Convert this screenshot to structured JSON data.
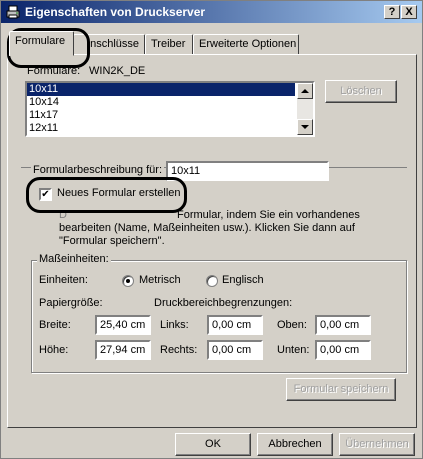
{
  "window": {
    "title": "Eigenschaften von Druckserver",
    "help_button": "?",
    "close_button": "X"
  },
  "tabs": [
    {
      "label": "Formulare"
    },
    {
      "label": "Anschlüsse"
    },
    {
      "label": "Treiber"
    },
    {
      "label": "Erweiterte Optionen"
    }
  ],
  "tab1_visible_label": "nschlüsse",
  "forms_label": "Formulare:",
  "forms_server": "WIN2K_DE",
  "forms_list": [
    "10x11",
    "10x14",
    "11x17",
    "12x11"
  ],
  "delete_button": "Löschen",
  "description": {
    "label": "Formularbeschreibung für:",
    "value": "10x11"
  },
  "create_new": {
    "label": "Neues Formular erstellen",
    "checked": "✔",
    "text_line1_left": "D",
    "text_line1_right": "Formular, indem Sie ein vorhandenes",
    "text_line2": "bearbeiten (Name, Maßeinheiten usw.). Klicken Sie dann auf",
    "text_line3": "\"Formular speichern\"."
  },
  "units_group": {
    "label": "Maßeinheiten:",
    "units_label": "Einheiten:",
    "metric": "Metrisch",
    "english": "Englisch",
    "paper_size_label": "Papiergröße:",
    "printable_area_label": "Druckbereichbegrenzungen:",
    "width_label": "Breite:",
    "width_value": "25,40 cm",
    "height_label": "Höhe:",
    "height_value": "27,94 cm",
    "left_label": "Links:",
    "left_value": "0,00 cm",
    "right_label": "Rechts:",
    "right_value": "0,00 cm",
    "top_label": "Oben:",
    "top_value": "0,00 cm",
    "bottom_label": "Unten:",
    "bottom_value": "0,00 cm"
  },
  "save_form_button": "Formular speichern",
  "footer": {
    "ok": "OK",
    "cancel": "Abbrechen",
    "apply": "Übernehmen"
  },
  "colors": {
    "title_gradient_start": "#0a246a",
    "title_gradient_end": "#a6caf0",
    "dialog_face": "#d4d0c8",
    "selection": "#0a246a",
    "callout": "#000000"
  }
}
